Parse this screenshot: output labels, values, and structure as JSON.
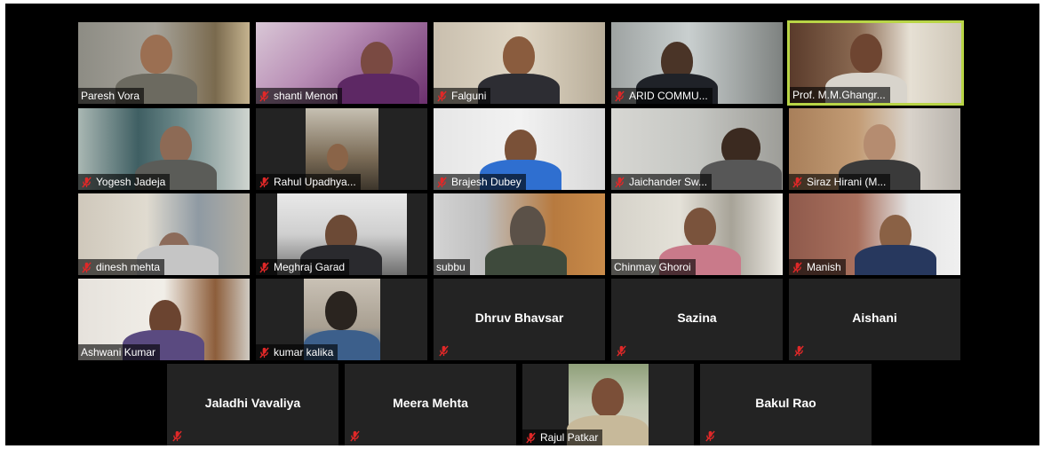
{
  "meeting": {
    "row1": [
      {
        "name": "Paresh Vora",
        "muted": false
      },
      {
        "name": "shanti Menon",
        "muted": true
      },
      {
        "name": "Falguni",
        "muted": true
      },
      {
        "name": "ARID COMMU...",
        "muted": true
      },
      {
        "name": "Prof. M.M.Ghangr...",
        "muted": false,
        "active_speaker": true
      }
    ],
    "row2": [
      {
        "name": "Yogesh Jadeja",
        "muted": true
      },
      {
        "name": "Rahul Upadhya...",
        "muted": true
      },
      {
        "name": "Brajesh Dubey",
        "muted": true
      },
      {
        "name": "Jaichander Sw...",
        "muted": true
      },
      {
        "name": "Siraz Hirani (M...",
        "muted": true
      }
    ],
    "row3": [
      {
        "name": "dinesh mehta",
        "muted": true
      },
      {
        "name": "Meghraj Garad",
        "muted": true
      },
      {
        "name": "subbu",
        "muted": false
      },
      {
        "name": "Chinmay Ghoroi",
        "muted": false
      },
      {
        "name": "Manish",
        "muted": true
      }
    ],
    "row4": [
      {
        "name": "Ashwani Kumar",
        "muted": false
      },
      {
        "name": "kumar kalika",
        "muted": true
      },
      {
        "name": "Dhruv Bhavsar",
        "muted": true,
        "video_off": true
      },
      {
        "name": "Sazina",
        "muted": true,
        "video_off": true
      },
      {
        "name": "Aishani",
        "muted": true,
        "video_off": true
      }
    ],
    "row5": [
      {
        "name": "Jaladhi Vavaliya",
        "muted": true,
        "video_off": true
      },
      {
        "name": "Meera Mehta",
        "muted": true,
        "video_off": true
      },
      {
        "name": "Rajul Patkar",
        "muted": true
      },
      {
        "name": "Bakul Rao",
        "muted": true,
        "video_off": true
      }
    ]
  },
  "colors": {
    "stage_bg": "#000000",
    "tile_bg": "#232323",
    "active_speaker_border": "#b9d546",
    "mute_icon": "#e02828"
  },
  "icons": {
    "muted": "muted-microphone-icon"
  }
}
